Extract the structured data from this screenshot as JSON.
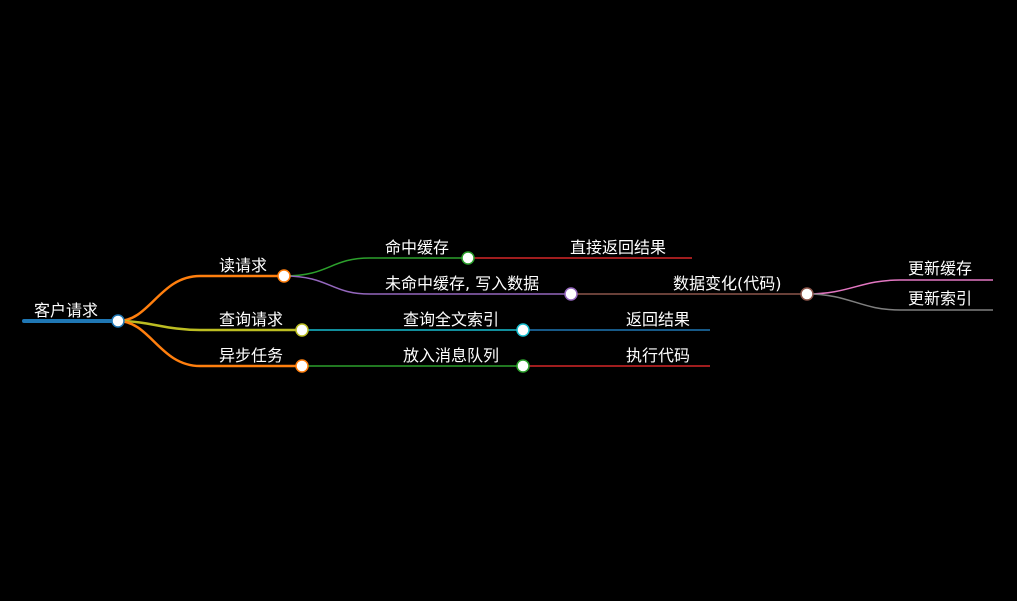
{
  "mindmap": {
    "root": {
      "label": "客户请求",
      "color": "#1f77b4"
    },
    "branches": [
      {
        "id": "read",
        "label": "读请求",
        "color": "#ff7f0e",
        "children": [
          {
            "label": "命中缓存",
            "color": "#2ca02c",
            "children": [
              {
                "label": "直接返回结果",
                "color": "#d62728"
              }
            ]
          },
          {
            "label": "未命中缓存, 写入数据",
            "color": "#9467bd",
            "children": [
              {
                "label": "数据变化(代码)",
                "color": "#8c564b",
                "children": [
                  {
                    "label": "更新缓存",
                    "color": "#e377c2"
                  },
                  {
                    "label": "更新索引",
                    "color": "#7f7f7f"
                  }
                ]
              }
            ]
          }
        ]
      },
      {
        "id": "query",
        "label": "查询请求",
        "color": "#bcbd22",
        "children": [
          {
            "label": "查询全文索引",
            "color": "#17becf",
            "children": [
              {
                "label": "返回结果",
                "color": "#1f77b4"
              }
            ]
          }
        ]
      },
      {
        "id": "async",
        "label": "异步任务",
        "color": "#ff7f0e",
        "children": [
          {
            "label": "放入消息队列",
            "color": "#2ca02c",
            "children": [
              {
                "label": "执行代码",
                "color": "#d62728"
              }
            ]
          }
        ]
      }
    ]
  }
}
